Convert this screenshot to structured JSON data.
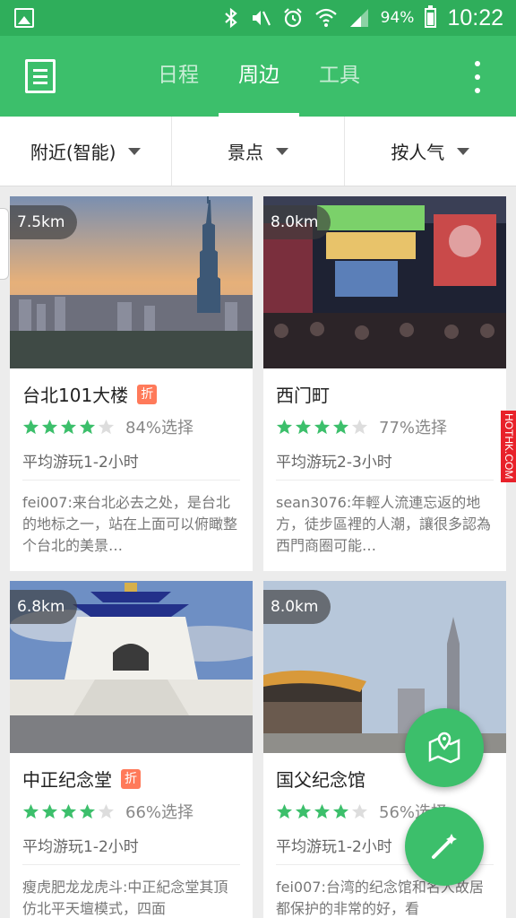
{
  "statusbar": {
    "battery": "94%",
    "time": "10:22"
  },
  "appbar": {
    "tabs": [
      {
        "label": "日程"
      },
      {
        "label": "周边"
      },
      {
        "label": "工具"
      }
    ]
  },
  "filters": [
    {
      "label": "附近(智能)"
    },
    {
      "label": "景点"
    },
    {
      "label": "按人气"
    }
  ],
  "cards": [
    {
      "distance": "7.5km",
      "title": "台北101大楼",
      "discount": "折",
      "stars": 4,
      "percent": "84%选择",
      "duration": "平均游玩1-2小时",
      "review": "fei007:来台北必去之处，是台北的地标之一，站在上面可以俯瞰整个台北的美景…"
    },
    {
      "distance": "8.0km",
      "title": "西门町",
      "discount": "",
      "stars": 4,
      "percent": "77%选择",
      "duration": "平均游玩2-3小时",
      "review": "sean3076:年輕人流連忘返的地方，徒步區裡的人潮，讓很多認為西門商圈可能…"
    },
    {
      "distance": "6.8km",
      "title": "中正纪念堂",
      "discount": "折",
      "stars": 4,
      "percent": "66%选择",
      "duration": "平均游玩1-2小时",
      "review": "瘦虎肥龙龙虎斗:中正紀念堂其頂仿北平天壇模式，四面"
    },
    {
      "distance": "8.0km",
      "title": "国父纪念馆",
      "discount": "",
      "stars": 4,
      "percent": "56%选择",
      "duration": "平均游玩1-2小时",
      "review": "fei007:台湾的纪念馆和名人故居都保护的非常的好，看"
    }
  ],
  "watermark": "HOTHK.COM",
  "colors": {
    "primary": "#3cbf6b",
    "statusbar": "#2fae5b",
    "star": "#3cbf6b",
    "discount": "#ff7a5a"
  }
}
